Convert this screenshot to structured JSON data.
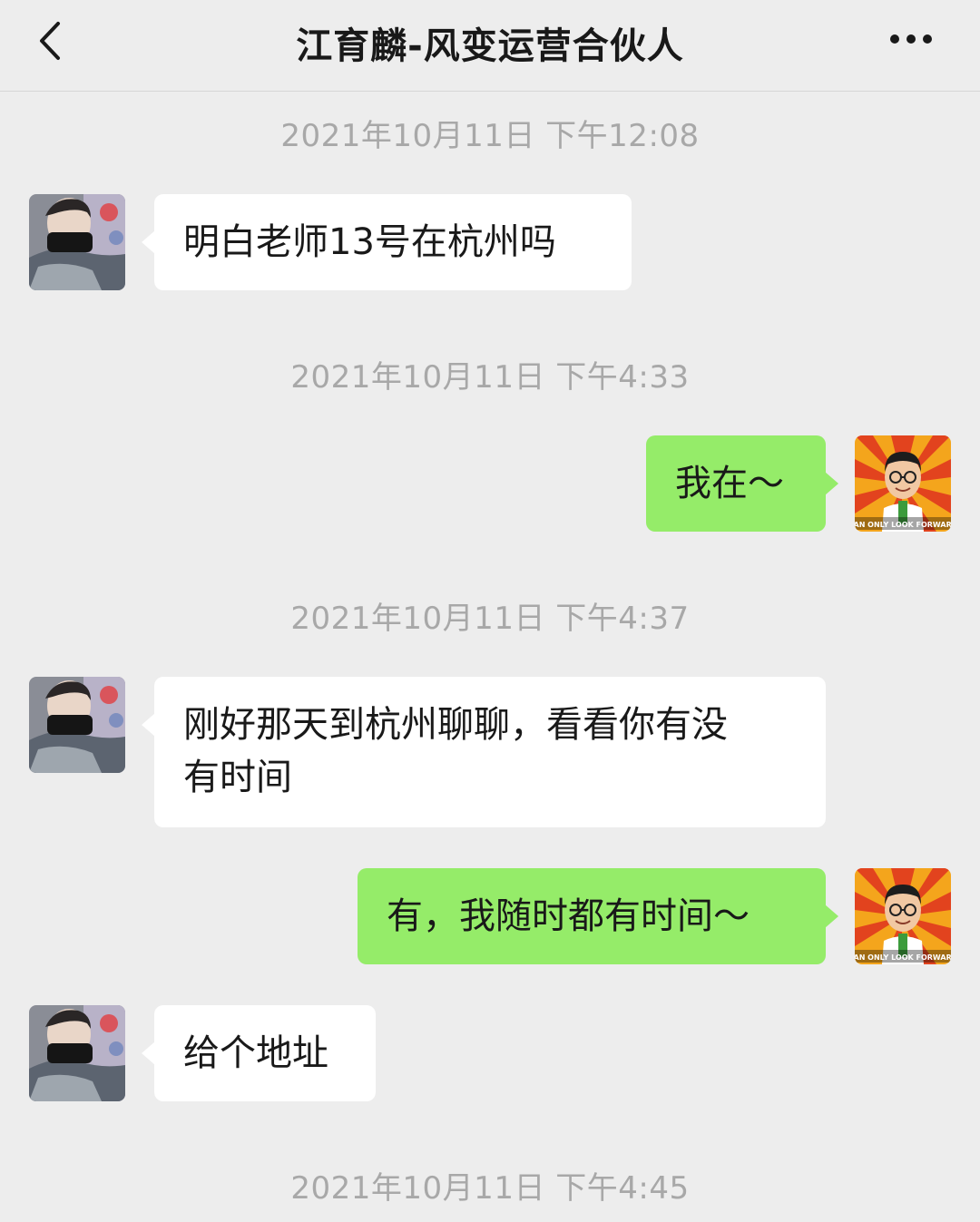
{
  "header": {
    "title": "江育麟-风变运营合伙人",
    "back_icon": "chevron-left-icon",
    "more_icon": "more-dots-icon"
  },
  "messages": [
    {
      "type": "timestamp",
      "text": "2021年10月11日 下午12:08"
    },
    {
      "type": "incoming",
      "text": "明白老师13号在杭州吗"
    },
    {
      "type": "timestamp",
      "text": "2021年10月11日 下午4:33"
    },
    {
      "type": "outgoing",
      "text": "我在～"
    },
    {
      "type": "timestamp",
      "text": "2021年10月11日 下午4:37"
    },
    {
      "type": "incoming",
      "lines": [
        "刚好那天到杭州聊聊，看看你有没",
        "有时间"
      ]
    },
    {
      "type": "outgoing",
      "text": "有，我随时都有时间～"
    },
    {
      "type": "incoming",
      "text": "给个地址"
    },
    {
      "type": "timestamp",
      "text": "2021年10月11日 下午4:45"
    }
  ],
  "avatars": {
    "contact_icon": "contact-avatar-photo",
    "self_icon": "cartoon-avatar",
    "self_avatar_caption": "CAN ONLY LOOK FORWARD"
  },
  "colors": {
    "background": "#ededed",
    "incoming_bubble": "#ffffff",
    "outgoing_bubble": "#95ec69",
    "timestamp_text": "#a8a8a8"
  }
}
